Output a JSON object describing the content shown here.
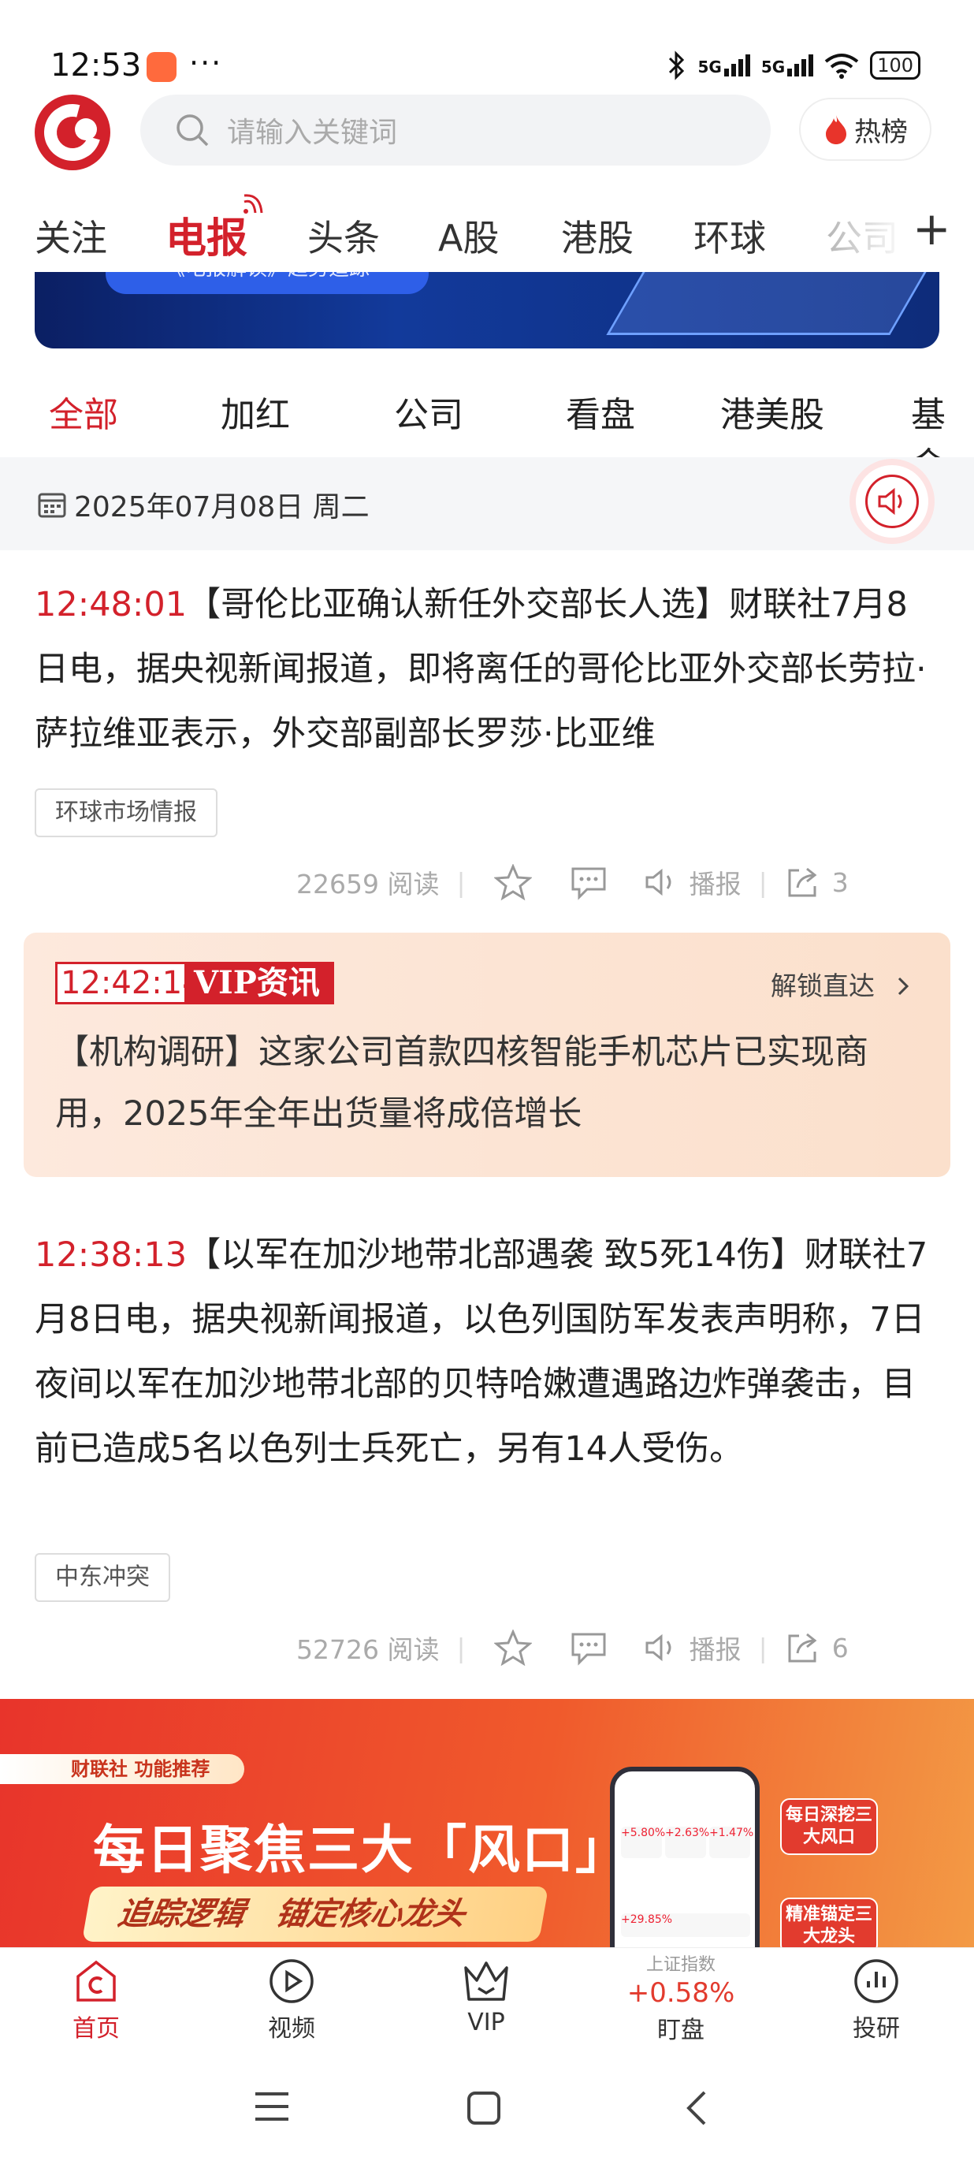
{
  "status": {
    "time": "12:53",
    "more": "···",
    "net1": "5G",
    "net2": "5G",
    "battery": "100"
  },
  "header": {
    "search_placeholder": "请输入关键词",
    "hot_label": "热榜"
  },
  "tabs": [
    "关注",
    "电报",
    "头条",
    "A股",
    "港股",
    "环球",
    "公司"
  ],
  "active_tab": "电报",
  "banner": {
    "pill_text": "《电报解读》趋势追踪"
  },
  "filters": [
    "全部",
    "加红",
    "公司",
    "看盘",
    "港美股",
    "基金"
  ],
  "active_filter": "全部",
  "date_line": "2025年07月08日 周二",
  "articles": [
    {
      "time": "12:48:01",
      "body": "【哥伦比亚确认新任外交部长人选】财联社7月8日电，据央视新闻报道，即将离任的哥伦比亚外交部长劳拉·萨拉维亚表示，外交部副部长罗莎·比亚维",
      "tag": "环球市场情报",
      "reads": "22659 阅读",
      "play": "播报",
      "shares": "3"
    },
    {
      "time": "12:38:13",
      "body": "【以军在加沙地带北部遇袭 致5死14伤】财联社7月8日电，据央视新闻报道，以色列国防军发表声明称，7日夜间以军在加沙地带北部的贝特哈嫩遭遇路边炸弹袭击，目前已造成5名以色列士兵死亡，另有14人受伤。",
      "tag": "中东冲突",
      "reads": "52726 阅读",
      "play": "播报",
      "shares": "6"
    }
  ],
  "vip": {
    "time": "12:42:14",
    "label": "VIP资讯",
    "unlock": "解锁直达",
    "text": "【机构调研】这家公司首款四核智能手机芯片已实现商用，2025年全年出货量将成倍增长"
  },
  "ad": {
    "kicker": "财联社 功能推荐",
    "headline": "每日聚焦三大「风口」",
    "sub_a": "追踪逻辑",
    "sub_b": "锚定核心龙头",
    "badge1": "每日深挖三大风口",
    "badge2": "精准锚定三大龙头",
    "phone_vals": [
      "+5.80%",
      "+2.63%",
      "+1.47%",
      "+29.85%"
    ]
  },
  "bottom_nav": [
    {
      "label": "首页"
    },
    {
      "label": "视频"
    },
    {
      "label": "VIP"
    },
    {
      "label": "盯盘",
      "index_name": "上证指数",
      "index_value": "+0.58%"
    },
    {
      "label": "投研"
    }
  ],
  "colors": {
    "brand_red": "#d3212b",
    "up_red": "#e23b2e"
  }
}
